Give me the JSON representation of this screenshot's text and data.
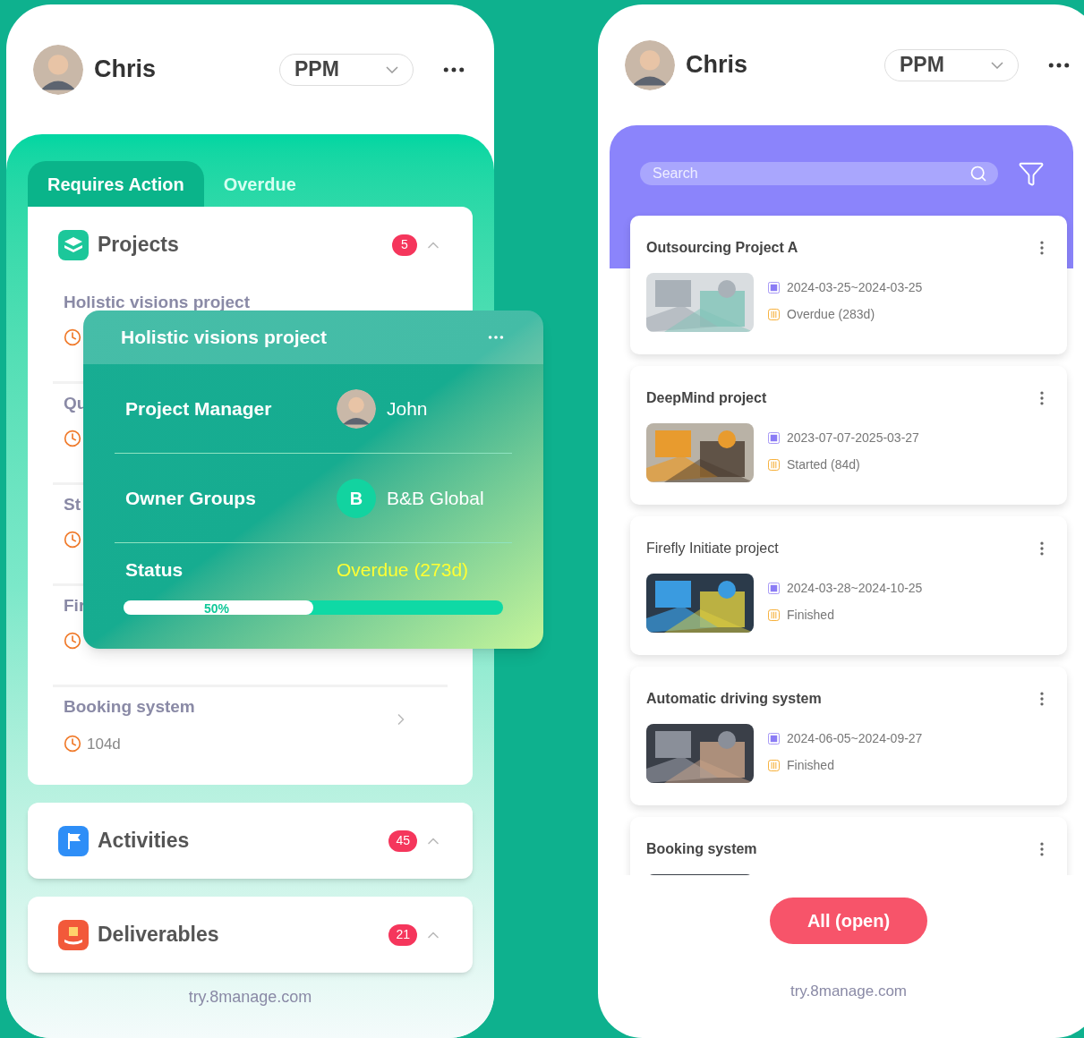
{
  "left_phone": {
    "user": "Chris",
    "dropdown": "PPM",
    "tabs": [
      {
        "label": "Requires Action",
        "selected": true
      },
      {
        "label": "Overdue",
        "selected": false
      }
    ],
    "sections": [
      {
        "kind": "projects",
        "title": "Projects",
        "count": "5",
        "expanded": true,
        "items": [
          {
            "name": "Holistic visions project"
          },
          {
            "name": "Qu"
          },
          {
            "name": "St"
          },
          {
            "name": "Fir"
          },
          {
            "name": "Booking system",
            "days": "104d"
          }
        ]
      },
      {
        "kind": "activities",
        "title": "Activities",
        "count": "45",
        "expanded": true
      },
      {
        "kind": "deliverables",
        "title": "Deliverables",
        "count": "21",
        "expanded": true
      }
    ],
    "footer": "try.8manage.com",
    "popup": {
      "title": "Holistic visions project",
      "rows": [
        {
          "kind": "person",
          "label": "Project Manager",
          "value": "John"
        },
        {
          "kind": "group",
          "label": "Owner Groups",
          "initial": "B",
          "value": "B&B Global"
        },
        {
          "kind": "status",
          "label": "Status",
          "value": "Overdue (273d)"
        }
      ],
      "progress": {
        "level": 0.5,
        "reading": "50%"
      }
    }
  },
  "right_phone": {
    "user": "Chris",
    "dropdown": "PPM",
    "search": {
      "placeholder": "Search"
    },
    "projects": [
      {
        "name": "Outsourcing Project A",
        "bold": true,
        "dates": "2024-03-25~2024-03-25",
        "status": "Overdue (283d)"
      },
      {
        "name": "DeepMind project",
        "bold": true,
        "dates": "2023-07-07-2025-03-27",
        "status": "Started (84d)"
      },
      {
        "name": "Firefly Initiate project",
        "bold": false,
        "dates": "2024-03-28~2024-10-25",
        "status": "Finished"
      },
      {
        "name": "Automatic driving system",
        "bold": true,
        "dates": "2024-06-05~2024-09-27",
        "status": "Finished"
      },
      {
        "name": "Booking system",
        "bold": true
      }
    ],
    "button": "All (open)",
    "footer": "try.8manage.com"
  }
}
